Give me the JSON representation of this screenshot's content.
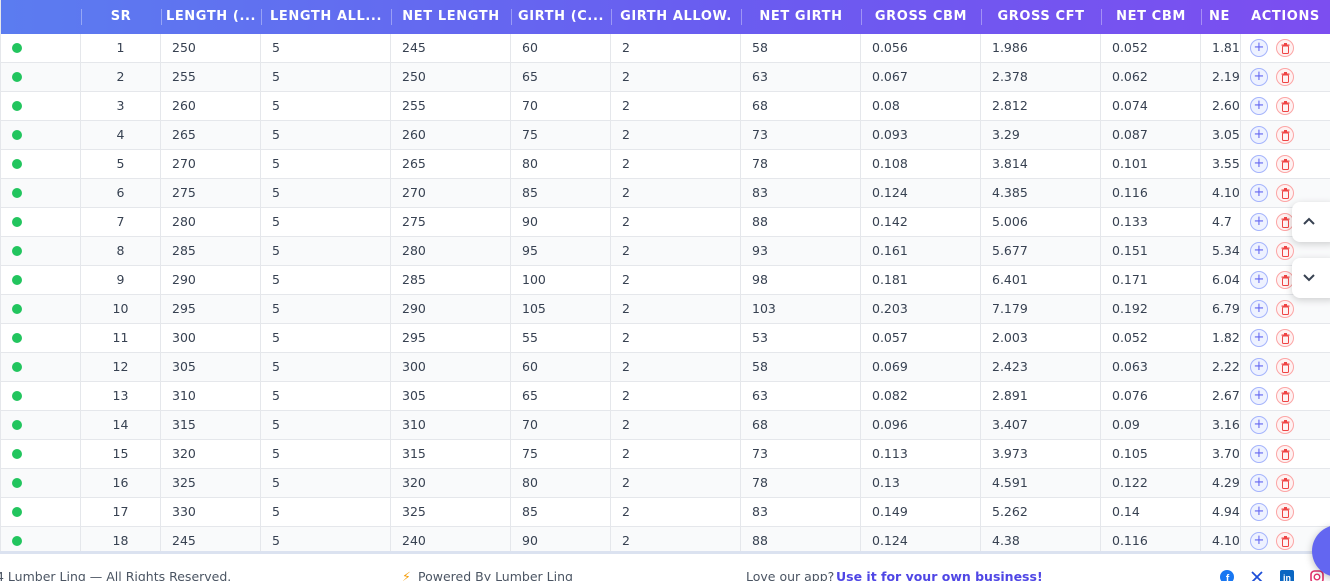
{
  "table": {
    "columns": [
      "",
      "SR",
      "LENGTH (...",
      "LENGTH ALL...",
      "NET LENGTH",
      "GIRTH (C...",
      "GIRTH ALLOW.",
      "NET GIRTH",
      "GROSS CBM",
      "GROSS CFT",
      "NET CBM",
      "NE",
      "ACTIONS"
    ],
    "rows": [
      {
        "sr": "1",
        "length": "250",
        "length_allow": "5",
        "net_length": "245",
        "girth": "60",
        "girth_allow": "2",
        "net_girth": "58",
        "gross_cbm": "0.056",
        "gross_cft": "1.986",
        "net_cbm": "0.052",
        "net_cft": "1.81"
      },
      {
        "sr": "2",
        "length": "255",
        "length_allow": "5",
        "net_length": "250",
        "girth": "65",
        "girth_allow": "2",
        "net_girth": "63",
        "gross_cbm": "0.067",
        "gross_cft": "2.378",
        "net_cbm": "0.062",
        "net_cft": "2.19"
      },
      {
        "sr": "3",
        "length": "260",
        "length_allow": "5",
        "net_length": "255",
        "girth": "70",
        "girth_allow": "2",
        "net_girth": "68",
        "gross_cbm": "0.08",
        "gross_cft": "2.812",
        "net_cbm": "0.074",
        "net_cft": "2.60"
      },
      {
        "sr": "4",
        "length": "265",
        "length_allow": "5",
        "net_length": "260",
        "girth": "75",
        "girth_allow": "2",
        "net_girth": "73",
        "gross_cbm": "0.093",
        "gross_cft": "3.29",
        "net_cbm": "0.087",
        "net_cft": "3.05"
      },
      {
        "sr": "5",
        "length": "270",
        "length_allow": "5",
        "net_length": "265",
        "girth": "80",
        "girth_allow": "2",
        "net_girth": "78",
        "gross_cbm": "0.108",
        "gross_cft": "3.814",
        "net_cbm": "0.101",
        "net_cft": "3.55"
      },
      {
        "sr": "6",
        "length": "275",
        "length_allow": "5",
        "net_length": "270",
        "girth": "85",
        "girth_allow": "2",
        "net_girth": "83",
        "gross_cbm": "0.124",
        "gross_cft": "4.385",
        "net_cbm": "0.116",
        "net_cft": "4.10"
      },
      {
        "sr": "7",
        "length": "280",
        "length_allow": "5",
        "net_length": "275",
        "girth": "90",
        "girth_allow": "2",
        "net_girth": "88",
        "gross_cbm": "0.142",
        "gross_cft": "5.006",
        "net_cbm": "0.133",
        "net_cft": "4.7"
      },
      {
        "sr": "8",
        "length": "285",
        "length_allow": "5",
        "net_length": "280",
        "girth": "95",
        "girth_allow": "2",
        "net_girth": "93",
        "gross_cbm": "0.161",
        "gross_cft": "5.677",
        "net_cbm": "0.151",
        "net_cft": "5.34"
      },
      {
        "sr": "9",
        "length": "290",
        "length_allow": "5",
        "net_length": "285",
        "girth": "100",
        "girth_allow": "2",
        "net_girth": "98",
        "gross_cbm": "0.181",
        "gross_cft": "6.401",
        "net_cbm": "0.171",
        "net_cft": "6.04"
      },
      {
        "sr": "10",
        "length": "295",
        "length_allow": "5",
        "net_length": "290",
        "girth": "105",
        "girth_allow": "2",
        "net_girth": "103",
        "gross_cbm": "0.203",
        "gross_cft": "7.179",
        "net_cbm": "0.192",
        "net_cft": "6.79"
      },
      {
        "sr": "11",
        "length": "300",
        "length_allow": "5",
        "net_length": "295",
        "girth": "55",
        "girth_allow": "2",
        "net_girth": "53",
        "gross_cbm": "0.057",
        "gross_cft": "2.003",
        "net_cbm": "0.052",
        "net_cft": "1.82"
      },
      {
        "sr": "12",
        "length": "305",
        "length_allow": "5",
        "net_length": "300",
        "girth": "60",
        "girth_allow": "2",
        "net_girth": "58",
        "gross_cbm": "0.069",
        "gross_cft": "2.423",
        "net_cbm": "0.063",
        "net_cft": "2.22"
      },
      {
        "sr": "13",
        "length": "310",
        "length_allow": "5",
        "net_length": "305",
        "girth": "65",
        "girth_allow": "2",
        "net_girth": "63",
        "gross_cbm": "0.082",
        "gross_cft": "2.891",
        "net_cbm": "0.076",
        "net_cft": "2.67"
      },
      {
        "sr": "14",
        "length": "315",
        "length_allow": "5",
        "net_length": "310",
        "girth": "70",
        "girth_allow": "2",
        "net_girth": "68",
        "gross_cbm": "0.096",
        "gross_cft": "3.407",
        "net_cbm": "0.09",
        "net_cft": "3.16"
      },
      {
        "sr": "15",
        "length": "320",
        "length_allow": "5",
        "net_length": "315",
        "girth": "75",
        "girth_allow": "2",
        "net_girth": "73",
        "gross_cbm": "0.113",
        "gross_cft": "3.973",
        "net_cbm": "0.105",
        "net_cft": "3.70"
      },
      {
        "sr": "16",
        "length": "325",
        "length_allow": "5",
        "net_length": "320",
        "girth": "80",
        "girth_allow": "2",
        "net_girth": "78",
        "gross_cbm": "0.13",
        "gross_cft": "4.591",
        "net_cbm": "0.122",
        "net_cft": "4.29"
      },
      {
        "sr": "17",
        "length": "330",
        "length_allow": "5",
        "net_length": "325",
        "girth": "85",
        "girth_allow": "2",
        "net_girth": "83",
        "gross_cbm": "0.149",
        "gross_cft": "5.262",
        "net_cbm": "0.14",
        "net_cft": "4.94"
      },
      {
        "sr": "18",
        "length": "245",
        "length_allow": "5",
        "net_length": "240",
        "girth": "90",
        "girth_allow": "2",
        "net_girth": "88",
        "gross_cbm": "0.124",
        "gross_cft": "4.38",
        "net_cbm": "0.116",
        "net_cft": "4.10"
      }
    ],
    "status_color": "#22c55e",
    "header_gradient": [
      "#5b7cf0",
      "#7c4ef0"
    ],
    "add_icon": "plus-icon",
    "delete_icon": "trash-icon"
  },
  "scroll_controls": {
    "up_icon": "chevron-up-icon",
    "down_icon": "chevron-down-icon"
  },
  "footer": {
    "copyright": "4 Lumber Ling — All Rights Reserved.",
    "powered_by": "Powered By Lumber Ling",
    "love_text": "Love our app?",
    "cta_link": "Use it for your own business!",
    "social_icons": [
      "facebook-icon",
      "x-icon",
      "linkedin-icon",
      "instagram-icon"
    ]
  }
}
